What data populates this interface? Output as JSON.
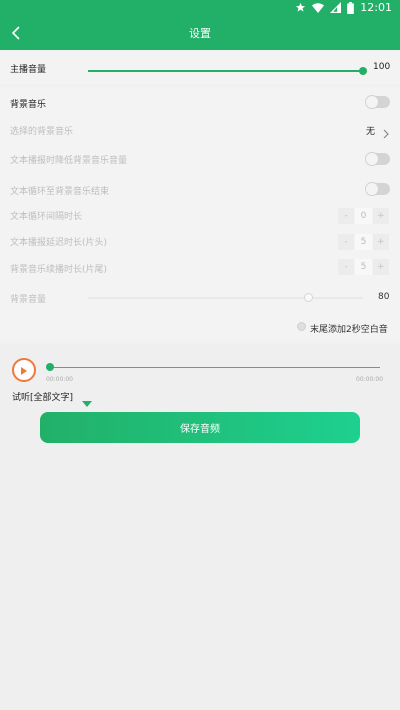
{
  "status_bar": {
    "time": "12:01",
    "icons": [
      "star-icon",
      "wifi-icon",
      "signal-icon",
      "battery-icon"
    ]
  },
  "header": {
    "title": "设置",
    "back_icon": "chevron-left-icon"
  },
  "master_volume": {
    "label": "主播音量",
    "value": "100",
    "level": 1.0
  },
  "bgm": {
    "label": "背景音乐",
    "enabled": false,
    "select_label": "选择的背景音乐",
    "select_value": "无",
    "duck_label": "文本播报时降低背景音乐音量",
    "loop_end_label": "文本循环至背景音乐结束",
    "loop_interval": {
      "label": "文本循环间隔时长",
      "minus": "-",
      "value": "0",
      "plus": "+"
    },
    "delay_head": {
      "label": "文本播报延迟时长(片头)",
      "minus": "-",
      "value": "5",
      "plus": "+"
    },
    "tail": {
      "label": "背景音乐续播时长(片尾)",
      "minus": "-",
      "value": "5",
      "plus": "+"
    },
    "volume": {
      "label": "背景音量",
      "value": "80",
      "level": 0.8
    },
    "silence_option": {
      "label": "末尾添加2秒空白音",
      "checked": false
    }
  },
  "player": {
    "time_start": "00:00:00",
    "time_end": "00:00:00",
    "progress": 0.0,
    "listen_label": "试听[全部文字]",
    "save_button": "保存音频"
  },
  "colors": {
    "accent": "#22b068",
    "accent_end": "#1ed08f",
    "play": "#f07838"
  }
}
